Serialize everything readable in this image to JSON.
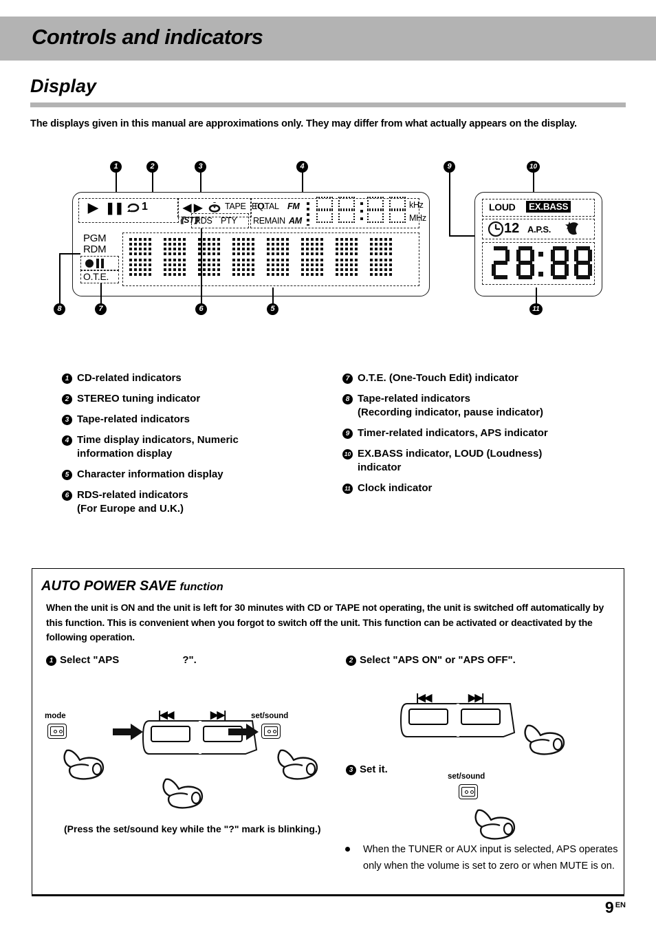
{
  "header": {
    "title": "Controls and indicators"
  },
  "section": {
    "title": "Display"
  },
  "intro": "The displays given in this manual are approximations only. They may differ from what actually appears on the display.",
  "display_panel": {
    "left": {
      "cd_row": {
        "play": "▶",
        "pause": "❚❚",
        "repeat_one": "1"
      },
      "tape_row": {
        "rev": "◀",
        "fwd": "▶",
        "repeat": "loop-icon",
        "tape": "TAPE",
        "eq": "EQ."
      },
      "stereo": "ST",
      "rds": "RDS",
      "pty": "PTY",
      "total": "TOTAL",
      "remain": "REMAIN",
      "fm": "FM",
      "am": "AM",
      "khz": "kHz",
      "mhz": "MHz",
      "pgm": "PGM",
      "rdm": "RDM",
      "ote": "O.T.E.",
      "numeric_value": "88:88"
    },
    "right": {
      "loud": "LOUD",
      "exbass": "EX.BASS",
      "timer_number": "12",
      "aps": "A.P.S.",
      "sleep_icon": "star-moon-icon",
      "clock_value": "28:88"
    },
    "callouts": [
      "1",
      "2",
      "3",
      "4",
      "5",
      "6",
      "7",
      "8",
      "9",
      "10",
      "11"
    ]
  },
  "legend": {
    "left": [
      {
        "n": "1",
        "line1": "CD-related indicators",
        "line2": ""
      },
      {
        "n": "2",
        "line1": "STEREO tuning indicator",
        "line2": ""
      },
      {
        "n": "3",
        "line1": "Tape-related indicators",
        "line2": ""
      },
      {
        "n": "4",
        "line1": "Time display indicators, Numeric",
        "line2": "information display"
      },
      {
        "n": "5",
        "line1": "Character information display",
        "line2": ""
      },
      {
        "n": "6",
        "line1": "RDS-related indicators",
        "line2": "(For Europe and U.K.)"
      }
    ],
    "right": [
      {
        "n": "7",
        "line1": "O.T.E. (One-Touch Edit) indicator",
        "line2": ""
      },
      {
        "n": "8",
        "line1": "Tape-related indicators",
        "line2": "(Recording indicator, pause indicator)"
      },
      {
        "n": "9",
        "line1": "Timer-related indicators, APS indicator",
        "line2": ""
      },
      {
        "n": "10",
        "line1": "EX.BASS indicator, LOUD (Loudness)",
        "line2": "indicator"
      },
      {
        "n": "11",
        "line1": "Clock indicator",
        "line2": ""
      }
    ]
  },
  "aps": {
    "title_strong": "AUTO POWER SAVE",
    "title_light": "function",
    "body": "When the unit is ON and the unit is left for 30 minutes with CD or TAPE not operating, the unit is switched off automatically by this function. This is convenient when you forgot to switch off the unit. This function can be activated or deactivated by the following operation.",
    "step1_num": "1",
    "step1_a": "Select \"APS",
    "step1_b": "?\".",
    "step2_num": "2",
    "step2": "Select \"APS ON\" or \"APS OFF\".",
    "step3_num": "3",
    "step3": "Set it.",
    "key_mode": "mode",
    "key_setsound": "set/sound",
    "key_setsound2": "set/sound",
    "key_setsound3": "set/sound",
    "skip_back": "|◀◀",
    "skip_fwd": "▶▶|",
    "skip_back2": "|◀◀",
    "skip_fwd2": "▶▶|",
    "note": "(Press the set/sound key while the \"?\" mark is blinking.)",
    "bullet_note": "When the TUNER or AUX input is selected, APS operates only when the volume is set to zero or when MUTE is on."
  },
  "footer": {
    "page": "9",
    "lang": "EN"
  },
  "colors": {
    "band": "#b3b3b3",
    "ink": "#000000",
    "paper": "#ffffff"
  }
}
